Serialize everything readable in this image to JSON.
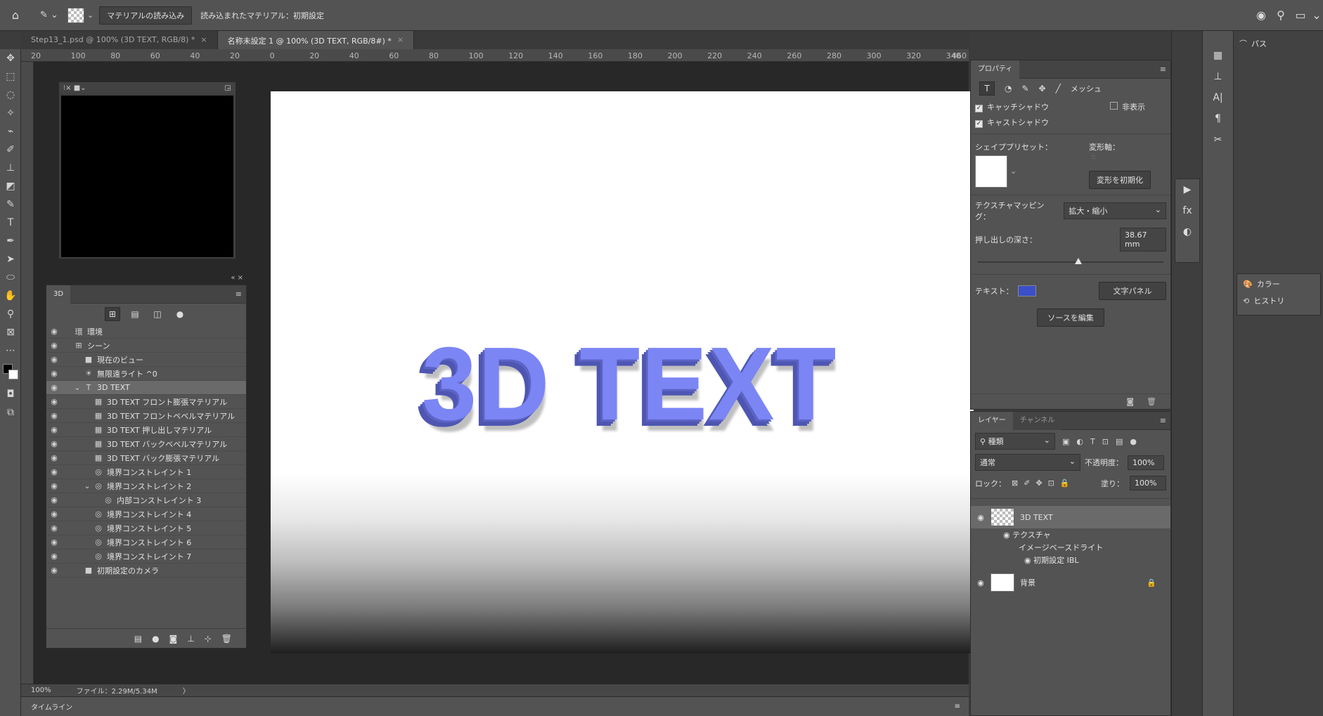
{
  "optbar": {
    "home_icon": "home-icon",
    "tool_icon": "material-drop-icon",
    "load_button": "マテリアルの読み込み",
    "loaded_label": "読み込まれたマテリアル：初期設定"
  },
  "tabs": [
    {
      "label": "Step13_1.psd @ 100% (3D TEXT, RGB/8) *",
      "active": false
    },
    {
      "label": "名称未設定 1 @ 100% (3D TEXT, RGB/8#) *",
      "active": true
    }
  ],
  "ruler_h": [
    "20",
    "100",
    "80",
    "60",
    "40",
    "20",
    "0",
    "20",
    "40",
    "60",
    "80",
    "100",
    "120",
    "140",
    "160",
    "180",
    "200",
    "220",
    "240",
    "260",
    "280",
    "300",
    "320",
    "340",
    "460"
  ],
  "canvas": {
    "text": "3D TEXT"
  },
  "panel3d": {
    "tab": "3D",
    "rows": [
      {
        "label": "環境",
        "indent": 0,
        "icon": "環",
        "eye": true
      },
      {
        "label": "シーン",
        "indent": 0,
        "icon": "⊞",
        "eye": true
      },
      {
        "label": "現在のビュー",
        "indent": 1,
        "icon": "■",
        "eye": true
      },
      {
        "label": "無限遠ライト ^0",
        "indent": 1,
        "icon": "☀",
        "eye": true
      },
      {
        "label": "3D TEXT",
        "indent": 1,
        "icon": "T",
        "eye": true,
        "selected": true,
        "caret": "v"
      },
      {
        "label": "3D TEXT フロント膨張マテリアル",
        "indent": 2,
        "icon": "▦",
        "eye": true
      },
      {
        "label": "3D TEXT フロントベベルマテリアル",
        "indent": 2,
        "icon": "▦",
        "eye": true
      },
      {
        "label": "3D TEXT 押し出しマテリアル",
        "indent": 2,
        "icon": "▦",
        "eye": true
      },
      {
        "label": "3D TEXT バックベベルマテリアル",
        "indent": 2,
        "icon": "▦",
        "eye": true
      },
      {
        "label": "3D TEXT バック膨張マテリアル",
        "indent": 2,
        "icon": "▦",
        "eye": true
      },
      {
        "label": "境界コンストレイント 1",
        "indent": 2,
        "icon": "◎",
        "eye": true
      },
      {
        "label": "境界コンストレイント 2",
        "indent": 2,
        "icon": "◎",
        "eye": true,
        "caret": "v"
      },
      {
        "label": "内部コンストレイント 3",
        "indent": 3,
        "icon": "◎",
        "eye": true
      },
      {
        "label": "境界コンストレイント 4",
        "indent": 2,
        "icon": "◎",
        "eye": true
      },
      {
        "label": "境界コンストレイント 5",
        "indent": 2,
        "icon": "◎",
        "eye": true
      },
      {
        "label": "境界コンストレイント 6",
        "indent": 2,
        "icon": "◎",
        "eye": true
      },
      {
        "label": "境界コンストレイント 7",
        "indent": 2,
        "icon": "◎",
        "eye": true
      },
      {
        "label": "初期設定のカメラ",
        "indent": 1,
        "icon": "■",
        "eye": true
      }
    ]
  },
  "props": {
    "tab": "プロパティ",
    "mesh_label": "メッシュ",
    "catch_shadow": "キャッチシャドウ",
    "cast_shadow": "キャストシャドウ",
    "hidden": "非表示",
    "shape_preset": "シェイププリセット：",
    "deform_axis": "変形軸：",
    "reset_deform": "変形を初期化",
    "texture_mapping_label": "テクスチャマッピング：",
    "texture_mapping_value": "拡大・縮小",
    "extrude_depth_label": "押し出しの深さ：",
    "extrude_depth_value": "38.67 mm",
    "extrude_slider_fraction": 0.54,
    "text_label": "テキスト：",
    "text_color": "#3a4fc9",
    "char_panel": "文字パネル",
    "edit_source": "ソースを編集"
  },
  "layers": {
    "tabs": [
      "レイヤー",
      "チャンネル"
    ],
    "filter_kind": "種類",
    "blend_mode": "通常",
    "opacity_label": "不透明度：",
    "opacity_value": "100%",
    "lock_label": "ロック：",
    "fill_label": "塗り：",
    "fill_value": "100%",
    "items": [
      {
        "name": "3D TEXT"
      },
      {
        "name": "テクスチャ"
      },
      {
        "name": "イメージベースドライト"
      },
      {
        "name": "初期設定 IBL"
      },
      {
        "name": "背景"
      }
    ]
  },
  "right_strip": {
    "paths_label": "パス",
    "color_label": "カラー",
    "history_label": "ヒストリ"
  },
  "status": {
    "zoom": "100%",
    "file": "ファイル：2.29M/5.34M",
    "arrow": "〉"
  },
  "timeline": "タイムライン"
}
